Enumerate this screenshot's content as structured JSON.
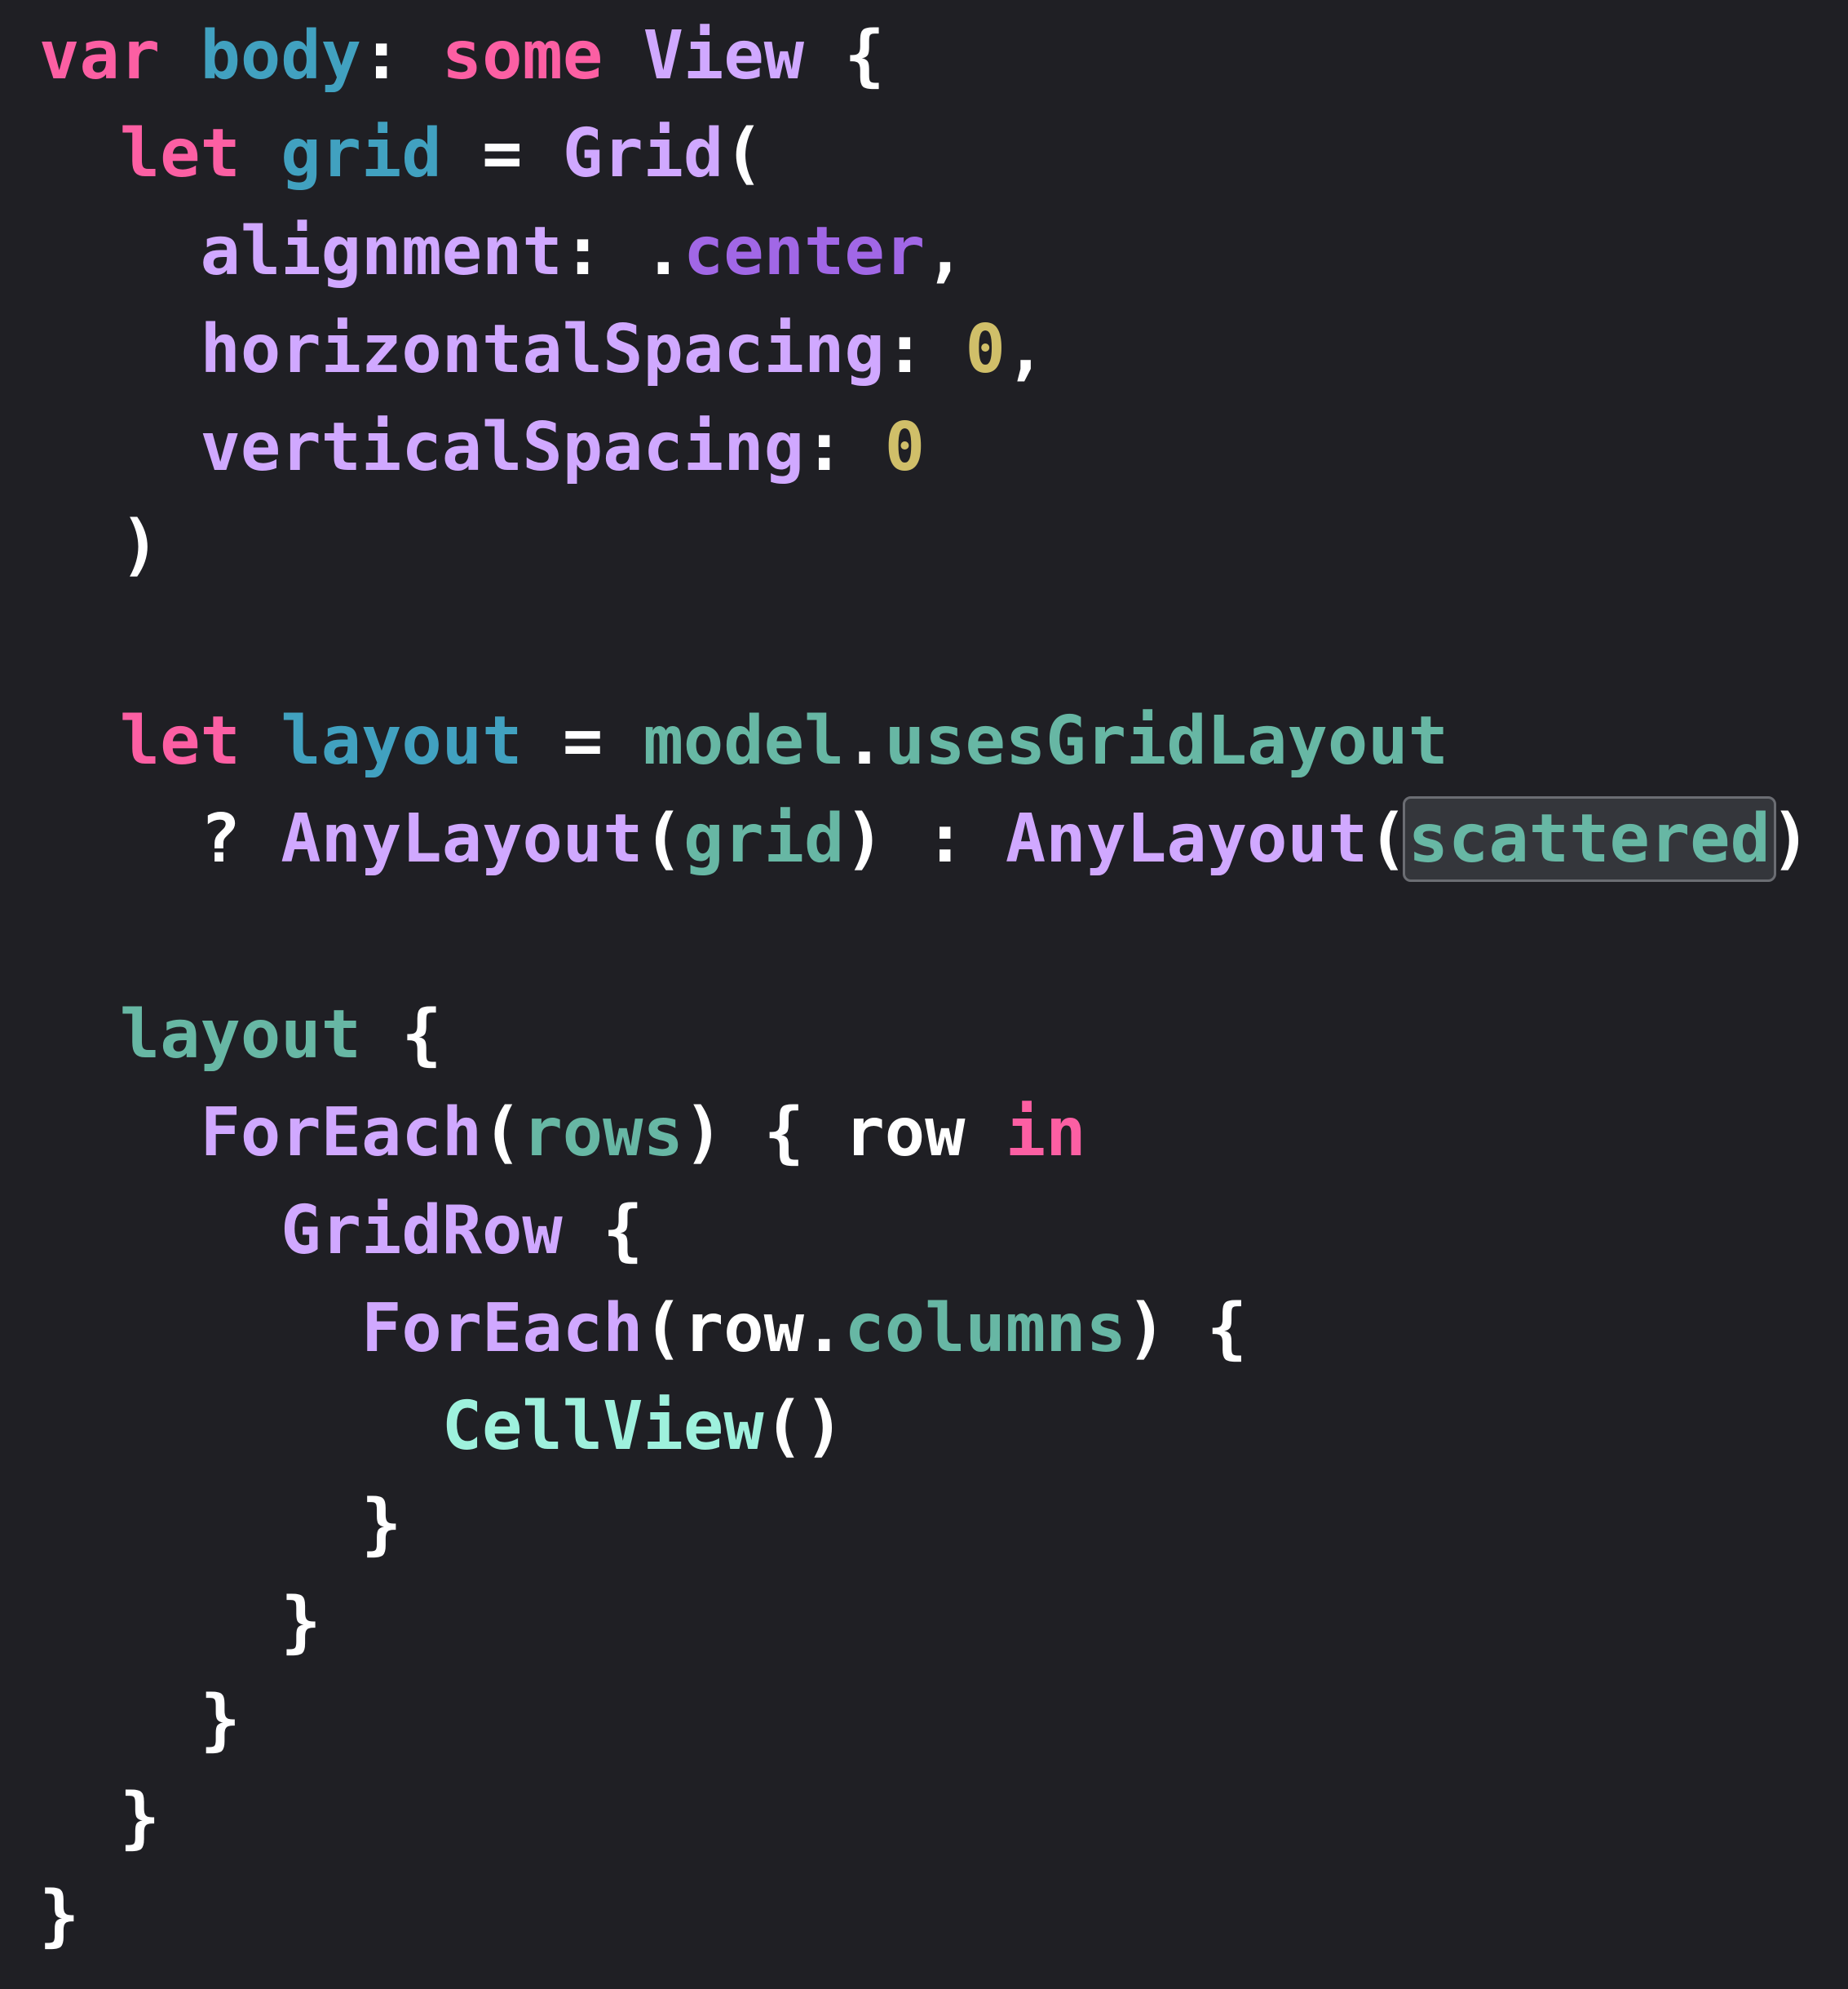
{
  "colors": {
    "background": "#1f1f24",
    "keyword": "#fc5fa3",
    "property": "#41a1c0",
    "type": "#d0a8ff",
    "member": "#a167e6",
    "number": "#d0bf69",
    "identifier": "#67b7a4",
    "call": "#9ef1dd",
    "plain": "#ffffff",
    "highlight_bg": "#34363b"
  },
  "code": {
    "l1": {
      "kw_var": "var",
      "sp1": " ",
      "prop_body": "body",
      "colon": ": ",
      "kw_some": "some",
      "sp2": " ",
      "type_view": "View",
      "brace": " {"
    },
    "l2": {
      "indent": "  ",
      "kw_let": "let",
      "sp1": " ",
      "prop_grid": "grid",
      "eq": " = ",
      "type_grid": "Grid",
      "paren": "("
    },
    "l3": {
      "indent": "    ",
      "label": "alignment",
      "colon": ": ",
      "dot": ".",
      "member_center": "center",
      "comma": ","
    },
    "l4": {
      "indent": "    ",
      "label": "horizontalSpacing",
      "colon": ": ",
      "num": "0",
      "comma": ","
    },
    "l5": {
      "indent": "    ",
      "label": "verticalSpacing",
      "colon": ": ",
      "num": "0"
    },
    "l6": {
      "indent": "  ",
      "paren": ")"
    },
    "l7": {
      "indent": "  ",
      "kw_let": "let",
      "sp1": " ",
      "prop_layout": "layout",
      "eq": " = ",
      "id_model": "model",
      "dot": ".",
      "id_uses": "usesGridLayout"
    },
    "l8": {
      "indent": "    ",
      "q": "? ",
      "type_any1": "AnyLayout",
      "p1": "(",
      "id_grid": "grid",
      "p2": ") : ",
      "type_any2": "AnyLayout",
      "p3": "(",
      "id_scattered": "scattered",
      "p4": ")"
    },
    "l9": {
      "indent": "  ",
      "id_layout": "layout",
      "brace": " {"
    },
    "l10": {
      "indent": "    ",
      "type_foreach": "ForEach",
      "p1": "(",
      "id_rows": "rows",
      "p2": ") { row ",
      "kw_in": "in"
    },
    "l11": {
      "indent": "      ",
      "type_gridrow": "GridRow",
      "brace": " {"
    },
    "l12": {
      "indent": "        ",
      "type_foreach": "ForEach",
      "p1": "(row.",
      "id_columns": "columns",
      "p2": ") {"
    },
    "l13": {
      "indent": "          ",
      "call_cellview": "CellView",
      "parens": "()"
    },
    "l14": {
      "indent": "        ",
      "brace": "}"
    },
    "l15": {
      "indent": "      ",
      "brace": "}"
    },
    "l16": {
      "indent": "    ",
      "brace": "}"
    },
    "l17": {
      "indent": "  ",
      "brace": "}"
    },
    "l18": {
      "brace": "}"
    }
  }
}
